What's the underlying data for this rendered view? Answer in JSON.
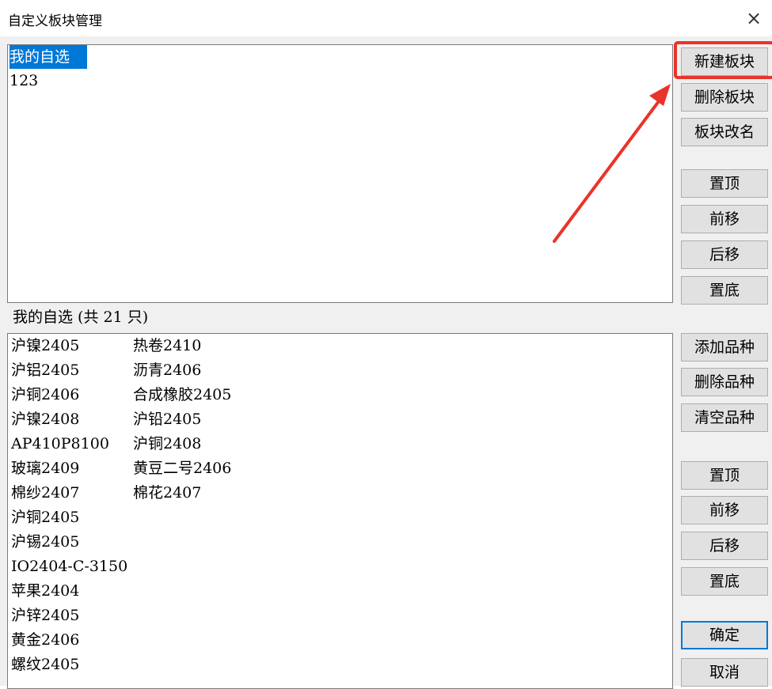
{
  "window": {
    "title": "自定义板块管理",
    "close_glyph": "×"
  },
  "sectors": {
    "items": [
      "我的自选",
      "123"
    ],
    "selected_index": 0
  },
  "sector_buttons": {
    "new": "新建板块",
    "delete": "删除板块",
    "rename": "板块改名",
    "top": "置顶",
    "up": "前移",
    "down": "后移",
    "bottom": "置底"
  },
  "stocks": {
    "count_label": "我的自选 (共 21 只)",
    "column_a": [
      "沪镍2405",
      "沪铝2405",
      "沪铜2406",
      "沪镍2408",
      "AP410P8100",
      "玻璃2409",
      "棉纱2407",
      "沪铜2405",
      "沪锡2405",
      "IO2404-C-3150",
      "苹果2404",
      "沪锌2405",
      "黄金2406",
      "螺纹2405"
    ],
    "column_b": [
      "热卷2410",
      "沥青2406",
      "合成橡胶2405",
      "沪铅2405",
      "沪铜2408",
      "黄豆二号2406",
      "棉花2407"
    ]
  },
  "stock_buttons": {
    "add": "添加品种",
    "delete": "删除品种",
    "clear": "清空品种",
    "top": "置顶",
    "up": "前移",
    "down": "后移",
    "bottom": "置底"
  },
  "dialog_buttons": {
    "ok": "确定",
    "cancel": "取消"
  },
  "annotation": {
    "color": "#e8342a",
    "target": "新建板块"
  },
  "colors": {
    "selection": "#0078d7",
    "button_face": "#e1e1e1",
    "dialog_bg": "#f0f0f0"
  }
}
